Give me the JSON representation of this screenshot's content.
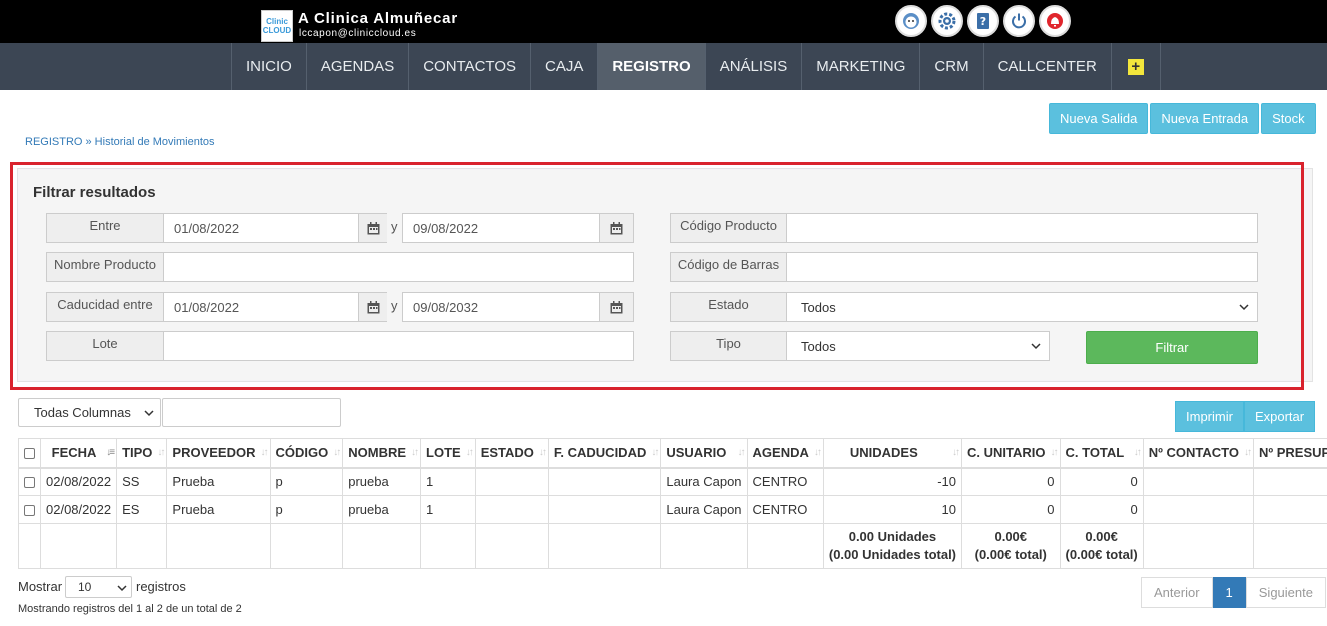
{
  "header": {
    "logo_text": "ClinicCloud",
    "clinic_name": "A Clinica Almuñecar",
    "email": "lccapon@cliniccloud.es",
    "icons": [
      "avatar-icon",
      "gear-icon",
      "help-icon",
      "power-icon",
      "alert-bell-icon"
    ]
  },
  "nav": {
    "items": [
      "INICIO",
      "AGENDAS",
      "CONTACTOS",
      "CAJA",
      "REGISTRO",
      "ANÁLISIS",
      "MARKETING",
      "CRM",
      "CALLCENTER"
    ],
    "active": "REGISTRO",
    "plus_label": "+"
  },
  "actions": {
    "nueva_salida": "Nueva Salida",
    "nueva_entrada": "Nueva Entrada",
    "stock": "Stock"
  },
  "breadcrumb": "REGISTRO » Historial de Movimientos",
  "filter": {
    "title": "Filtrar resultados",
    "entre_label": "Entre",
    "entre_from": "01/08/2022",
    "y": "y",
    "entre_to": "09/08/2022",
    "nombre_producto_label": "Nombre Producto",
    "nombre_producto_value": "",
    "caducidad_label": "Caducidad entre",
    "caducidad_from": "01/08/2022",
    "caducidad_to": "09/08/2032",
    "lote_label": "Lote",
    "lote_value": "",
    "codigo_producto_label": "Código Producto",
    "codigo_producto_value": "",
    "codigo_barras_label": "Código de Barras",
    "codigo_barras_value": "",
    "estado_label": "Estado",
    "estado_value": "Todos",
    "tipo_label": "Tipo",
    "tipo_value": "Todos",
    "filtrar": "Filtrar"
  },
  "table_controls": {
    "columns_select": "Todas Columnas",
    "search_value": "",
    "imprimir": "Imprimir",
    "exportar": "Exportar"
  },
  "table": {
    "headers": [
      "FECHA",
      "TIPO",
      "PROVEEDOR",
      "CÓDIGO",
      "NOMBRE",
      "LOTE",
      "ESTADO",
      "F. CADUCIDAD",
      "USUARIO",
      "AGENDA",
      "UNIDADES",
      "C. UNITARIO",
      "C. TOTAL",
      "Nº CONTACTO",
      "Nº PRESUPUESTO"
    ],
    "rows": [
      [
        "02/08/2022",
        "SS",
        "Prueba",
        "p",
        "prueba",
        "1",
        "",
        "",
        "Laura Capon",
        "CENTRO",
        "-10",
        "0",
        "0",
        "",
        ""
      ],
      [
        "02/08/2022",
        "ES",
        "Prueba",
        "p",
        "prueba",
        "1",
        "",
        "",
        "Laura Capon",
        "CENTRO",
        "10",
        "0",
        "0",
        "",
        ""
      ]
    ],
    "totals": {
      "unidades_1": "0.00 Unidades",
      "unidades_2": "(0.00 Unidades total)",
      "unitario_1": "0.00€",
      "unitario_2": "(0.00€ total)",
      "total_1": "0.00€",
      "total_2": "(0.00€ total)"
    }
  },
  "footer": {
    "mostrar": "Mostrar",
    "page_size": "10",
    "registros": "registros",
    "info": "Mostrando registros del 1 al 2 de un total de 2",
    "anterior": "Anterior",
    "page": "1",
    "siguiente": "Siguiente"
  },
  "colors": {
    "nav_bg": "#3c4654",
    "info_btn": "#5bc0de",
    "success_btn": "#5cb85c",
    "highlight_outline": "#d9232d"
  }
}
